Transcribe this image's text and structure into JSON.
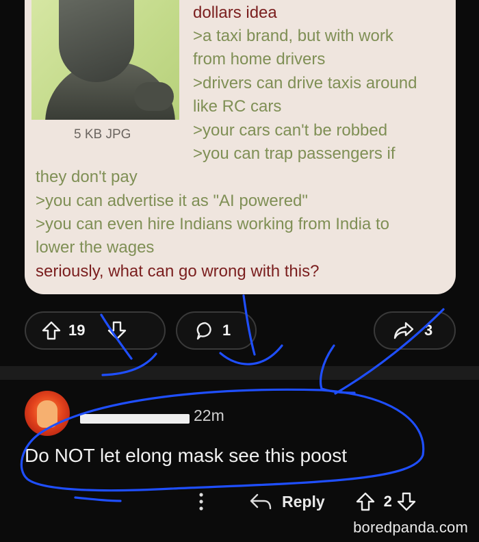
{
  "post": {
    "file_meta": "5 KB JPG",
    "lines": {
      "top": "dollars idea",
      "l1": ">a taxi brand, but with work",
      "l2": "from home drivers",
      "l3": ">drivers can drive taxis around",
      "l4": "like RC cars",
      "l5": ">your cars can't be robbed",
      "l6": ">you can trap passengers if",
      "l7": "they don't pay",
      "l8": ">you can advertise it as \"AI powered\"",
      "l9": ">you can even hire Indians working from India to",
      "l10": "lower the wages",
      "end": "seriously, what can go wrong with this?"
    },
    "actions": {
      "upvotes": "19",
      "comments": "1",
      "shares": "3"
    }
  },
  "comment": {
    "time": "22m",
    "text": "Do NOT let elong mask see this poost",
    "reply_label": "Reply",
    "votes": "2"
  },
  "watermark": "boredpanda.com",
  "colors": {
    "card_bg": "#efe5de",
    "greentext": "#7f8f55",
    "post_text": "#7a1e1e",
    "annotation_ink": "#1f4fff"
  }
}
